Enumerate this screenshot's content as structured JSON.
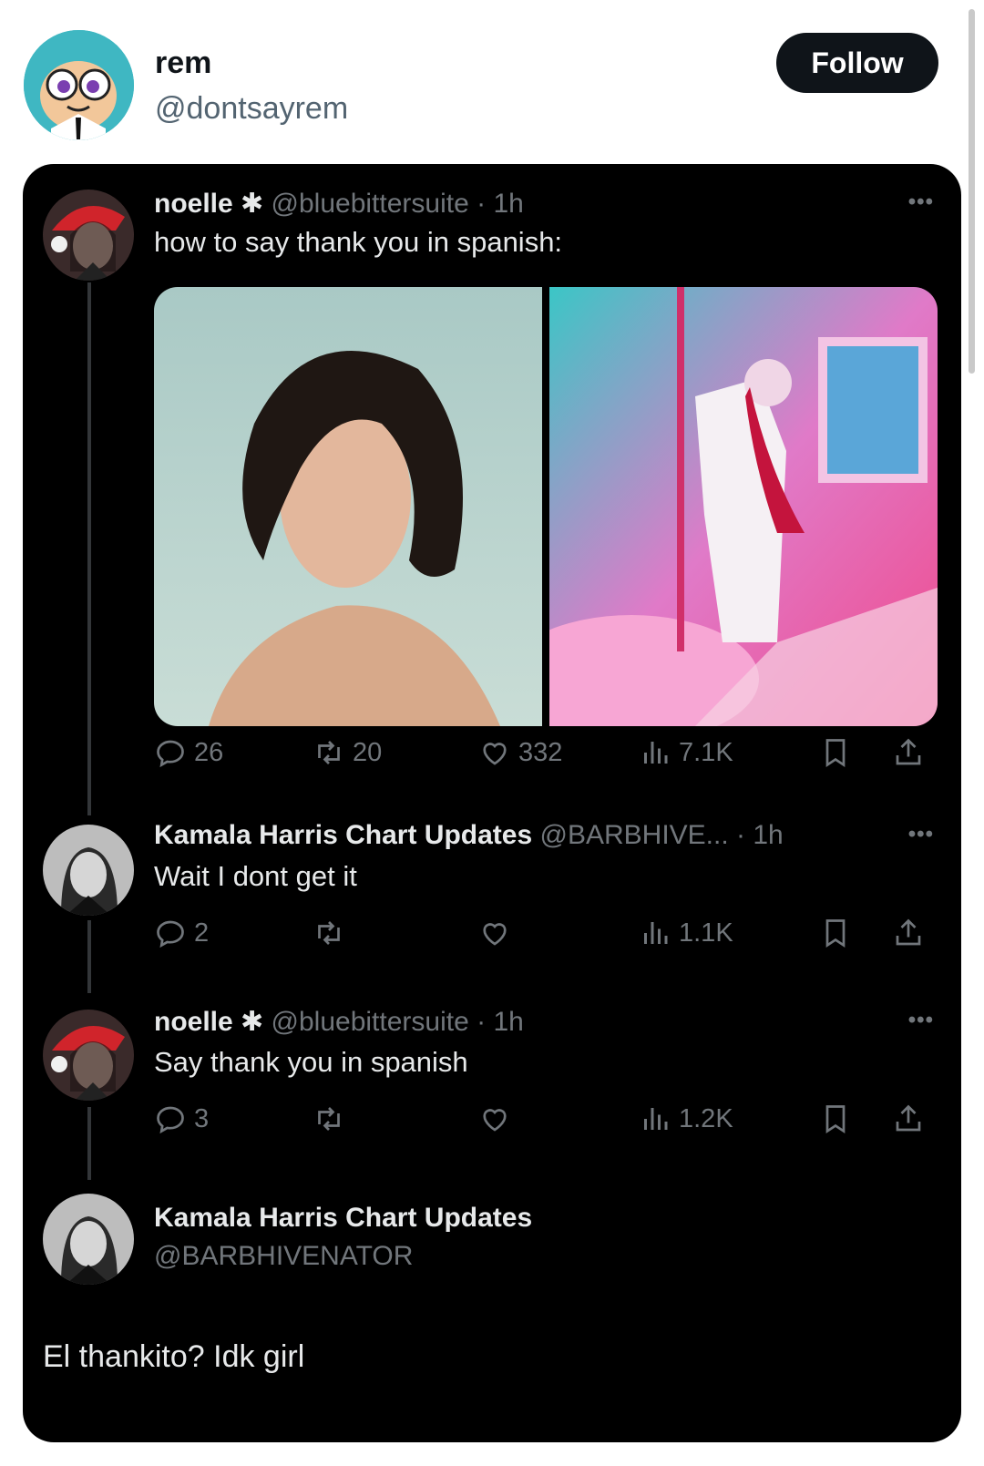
{
  "header": {
    "name": "rem",
    "handle": "@dontsayrem",
    "follow_label": "Follow"
  },
  "tweets": [
    {
      "name": "noelle",
      "badge": "✱",
      "handle": "@bluebittersuite",
      "time": "· 1h",
      "text": "how to say thank you in spanish:",
      "replies": "26",
      "retweets": "20",
      "likes": "332",
      "views": "7.1K"
    },
    {
      "name": "Kamala Harris Chart Updates",
      "handle": "@BARBHIVE...",
      "time": "· 1h",
      "text": "Wait I dont get it",
      "replies": "2",
      "retweets": "",
      "likes": "",
      "views": "1.1K"
    },
    {
      "name": "noelle",
      "badge": "✱",
      "handle": "@bluebittersuite",
      "time": "· 1h",
      "text": "Say thank you in spanish",
      "replies": "3",
      "retweets": "",
      "likes": "",
      "views": "1.2K"
    }
  ],
  "composer": {
    "name": "Kamala Harris Chart Updates",
    "handle": "@BARBHIVENATOR",
    "text": "El thankito? Idk girl"
  },
  "icons": {
    "reply": "reply-icon",
    "retweet": "retweet-icon",
    "like": "heart-icon",
    "views": "views-icon",
    "bookmark": "bookmark-icon",
    "share": "share-icon",
    "more": "more-icon"
  },
  "colors": {
    "card_bg": "#000000",
    "text_primary": "#e7e9ea",
    "text_secondary": "#71767b",
    "follow_bg": "#0f1419"
  }
}
